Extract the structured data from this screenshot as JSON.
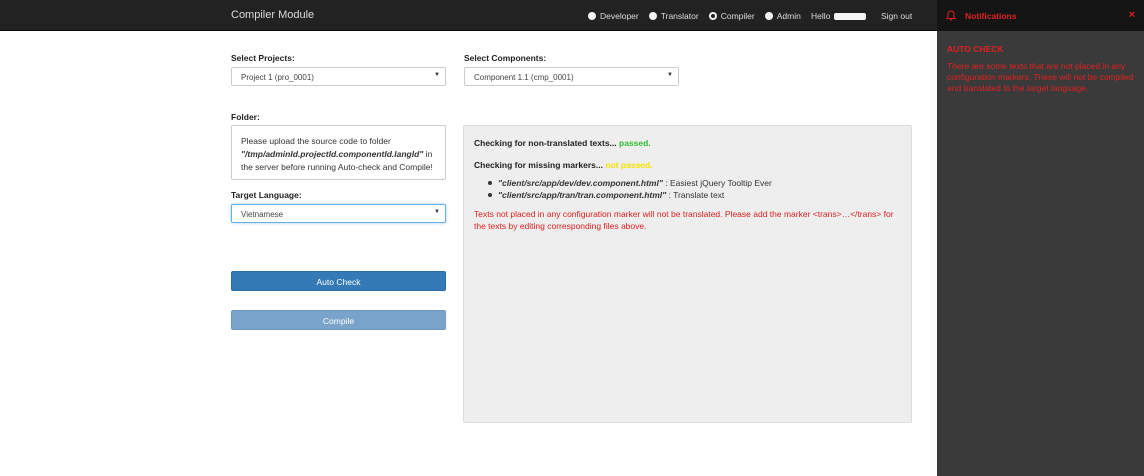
{
  "navbar": {
    "brand": "Compiler Module",
    "roles": [
      {
        "label": "Developer",
        "checked": false
      },
      {
        "label": "Translator",
        "checked": false
      },
      {
        "label": "Compiler",
        "checked": true
      },
      {
        "label": "Admin",
        "checked": false
      }
    ],
    "hello": "Hello",
    "signout": "Sign out"
  },
  "form": {
    "projects_label": "Select Projects:",
    "projects_value": "Project 1 (pro_0001)",
    "components_label": "Select Components:",
    "components_value": "Component 1.1 (cmp_0001)",
    "folder_label": "Folder:",
    "folder_text_1": "Please upload the source code to folder ",
    "folder_path": "\"/tmp/adminId.projectId.componentId.langId\"",
    "folder_text_2": " in the server before running Auto-check and Compile!",
    "language_label": "Target Language:",
    "language_value": "Vietnamese",
    "autocheck_button": "Auto Check",
    "compile_button": "Compile"
  },
  "result": {
    "check1_label": "Checking for non-translated texts...",
    "check1_status": "passed.",
    "check2_label": "Checking for missing markers...",
    "check2_status": "not passed.",
    "items": [
      {
        "path": "\"client/src/app/dev/dev.component.html\"",
        "text": " : Easiest jQuery Tooltip Ever"
      },
      {
        "path": "\"client/src/app/tran/tran.component.html\"",
        "text": " : Translate text"
      }
    ],
    "error": "Texts not placed in any configuration marker will not be translated. Please add the marker <trans>…</trans> for the texts by editing corresponding files above."
  },
  "notifications": {
    "title": "Notifications",
    "close": "×",
    "subtitle": "AUTO CHECK",
    "message": "There are some texts that are not placed in any configuration markers. These will not be compiled and translated to the target language."
  },
  "colors": {
    "navbar": "#222222",
    "primary": "#337ab7",
    "passed": "#2fbf2f",
    "not_passed": "#f5e300",
    "error": "#e02020",
    "sidebar": "#3a3a3a"
  }
}
